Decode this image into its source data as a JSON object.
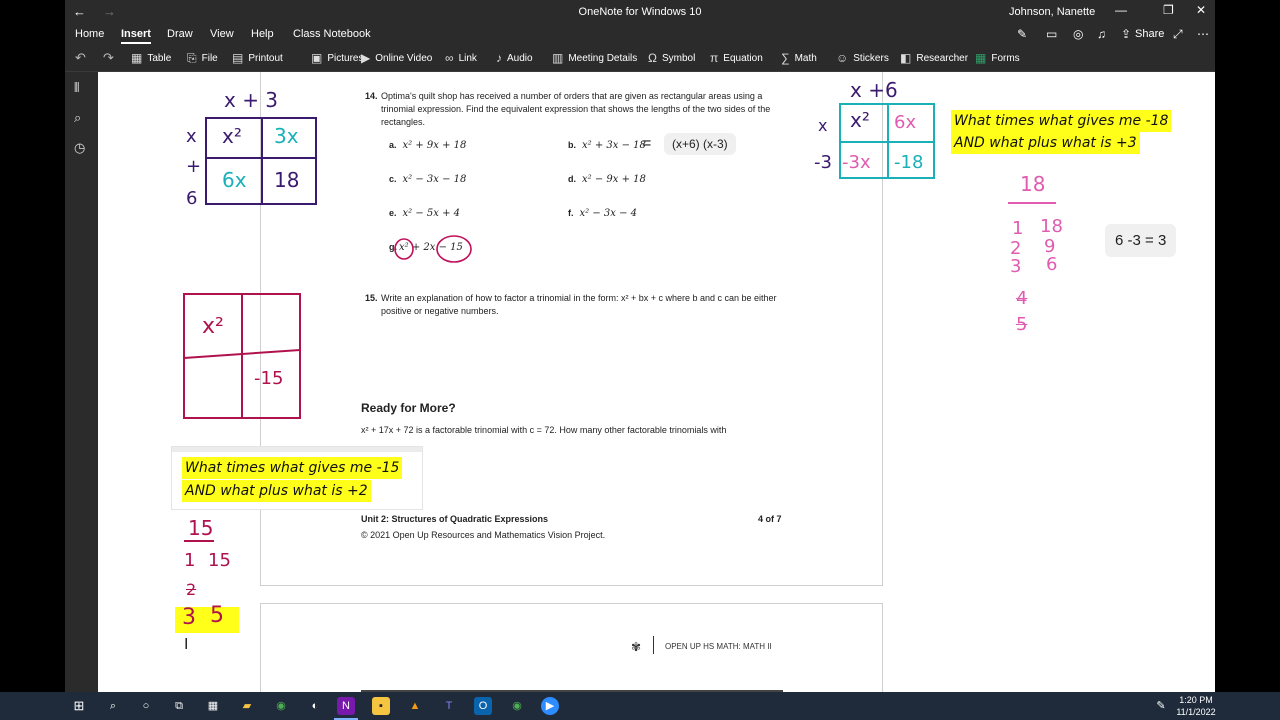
{
  "window": {
    "title": "OneNote for Windows 10",
    "user": "Johnson, Nanette",
    "back_icon": "back-arrow-icon",
    "fwd_icon": "forward-arrow-icon"
  },
  "menu": {
    "items": [
      "Home",
      "Insert",
      "Draw",
      "View",
      "Help",
      "Class Notebook"
    ],
    "active": "Insert",
    "share_label": "Share"
  },
  "ribbon": {
    "tools": [
      "Table",
      "File",
      "Printout",
      "Pictures",
      "Online Video",
      "Link",
      "Audio",
      "Meeting Details",
      "Symbol",
      "Equation",
      "Math",
      "Stickers",
      "Researcher",
      "Forms"
    ]
  },
  "worksheet": {
    "p14": {
      "num": "14.",
      "text": "Optima's quilt shop has received a number of orders that are given as rectangular areas using a trinomial expression. Find the equivalent expression that shows the lengths of the two sides of the rectangles.",
      "options": {
        "a": {
          "label": "a.",
          "expr": "x² + 9x + 18"
        },
        "b": {
          "label": "b.",
          "expr": "x² + 3x − 18"
        },
        "c": {
          "label": "c.",
          "expr": "x² − 3x − 18"
        },
        "d": {
          "label": "d.",
          "expr": "x² − 9x + 18"
        },
        "e": {
          "label": "e.",
          "expr": "x² − 5x + 4"
        },
        "f": {
          "label": "f.",
          "expr": "x² − 3x − 4"
        },
        "g": {
          "label": "g.",
          "expr": "x² + 2x − 15"
        }
      }
    },
    "p15": {
      "num": "15.",
      "text": "Write an explanation of how to factor a trinomial in the form: x² + bx + c where b and c can be either positive or negative numbers."
    },
    "ready_title": "Ready for More?",
    "ready_text": "x² + 17x + 72 is a factorable trinomial with c = 72. How many other factorable trinomials with",
    "footer_unit": "Unit 2: Structures of Quadratic Expressions",
    "footer_page": "4 of 7",
    "footer_copy": "© 2021 Open Up Resources and Mathematics Vision Project.",
    "page2_brand": "OPEN UP HS MATH: MATH II"
  },
  "notes": {
    "answer_b": "(x+6) (x-3)",
    "q_right_1": "What times what gives me -18",
    "q_right_2": "AND what plus what is +3",
    "sum_box": "6 -3 = 3",
    "q_left_1": "What times what gives me -15",
    "q_left_2": "AND what plus what is +2"
  },
  "ink": {
    "grid1_top": "x + 3",
    "grid1_side": [
      "x",
      "+",
      "6"
    ],
    "grid1_cells": [
      "x²",
      "3x",
      "6x",
      "18"
    ],
    "grid2_top": "x +6",
    "grid2_side": [
      "x",
      "-3"
    ],
    "grid2_cells": [
      "x²",
      "6x",
      "-3x",
      "-18"
    ],
    "grid3_cells": [
      "x²",
      "-15"
    ],
    "right_factors": [
      "18",
      "1",
      "18",
      "2",
      "9",
      "3",
      "6",
      "4",
      "5"
    ],
    "left_factors": [
      "15",
      "1",
      "15",
      "2",
      "3",
      "5"
    ]
  },
  "taskbar": {
    "time": "1:20 PM",
    "date": "11/1/2022"
  }
}
